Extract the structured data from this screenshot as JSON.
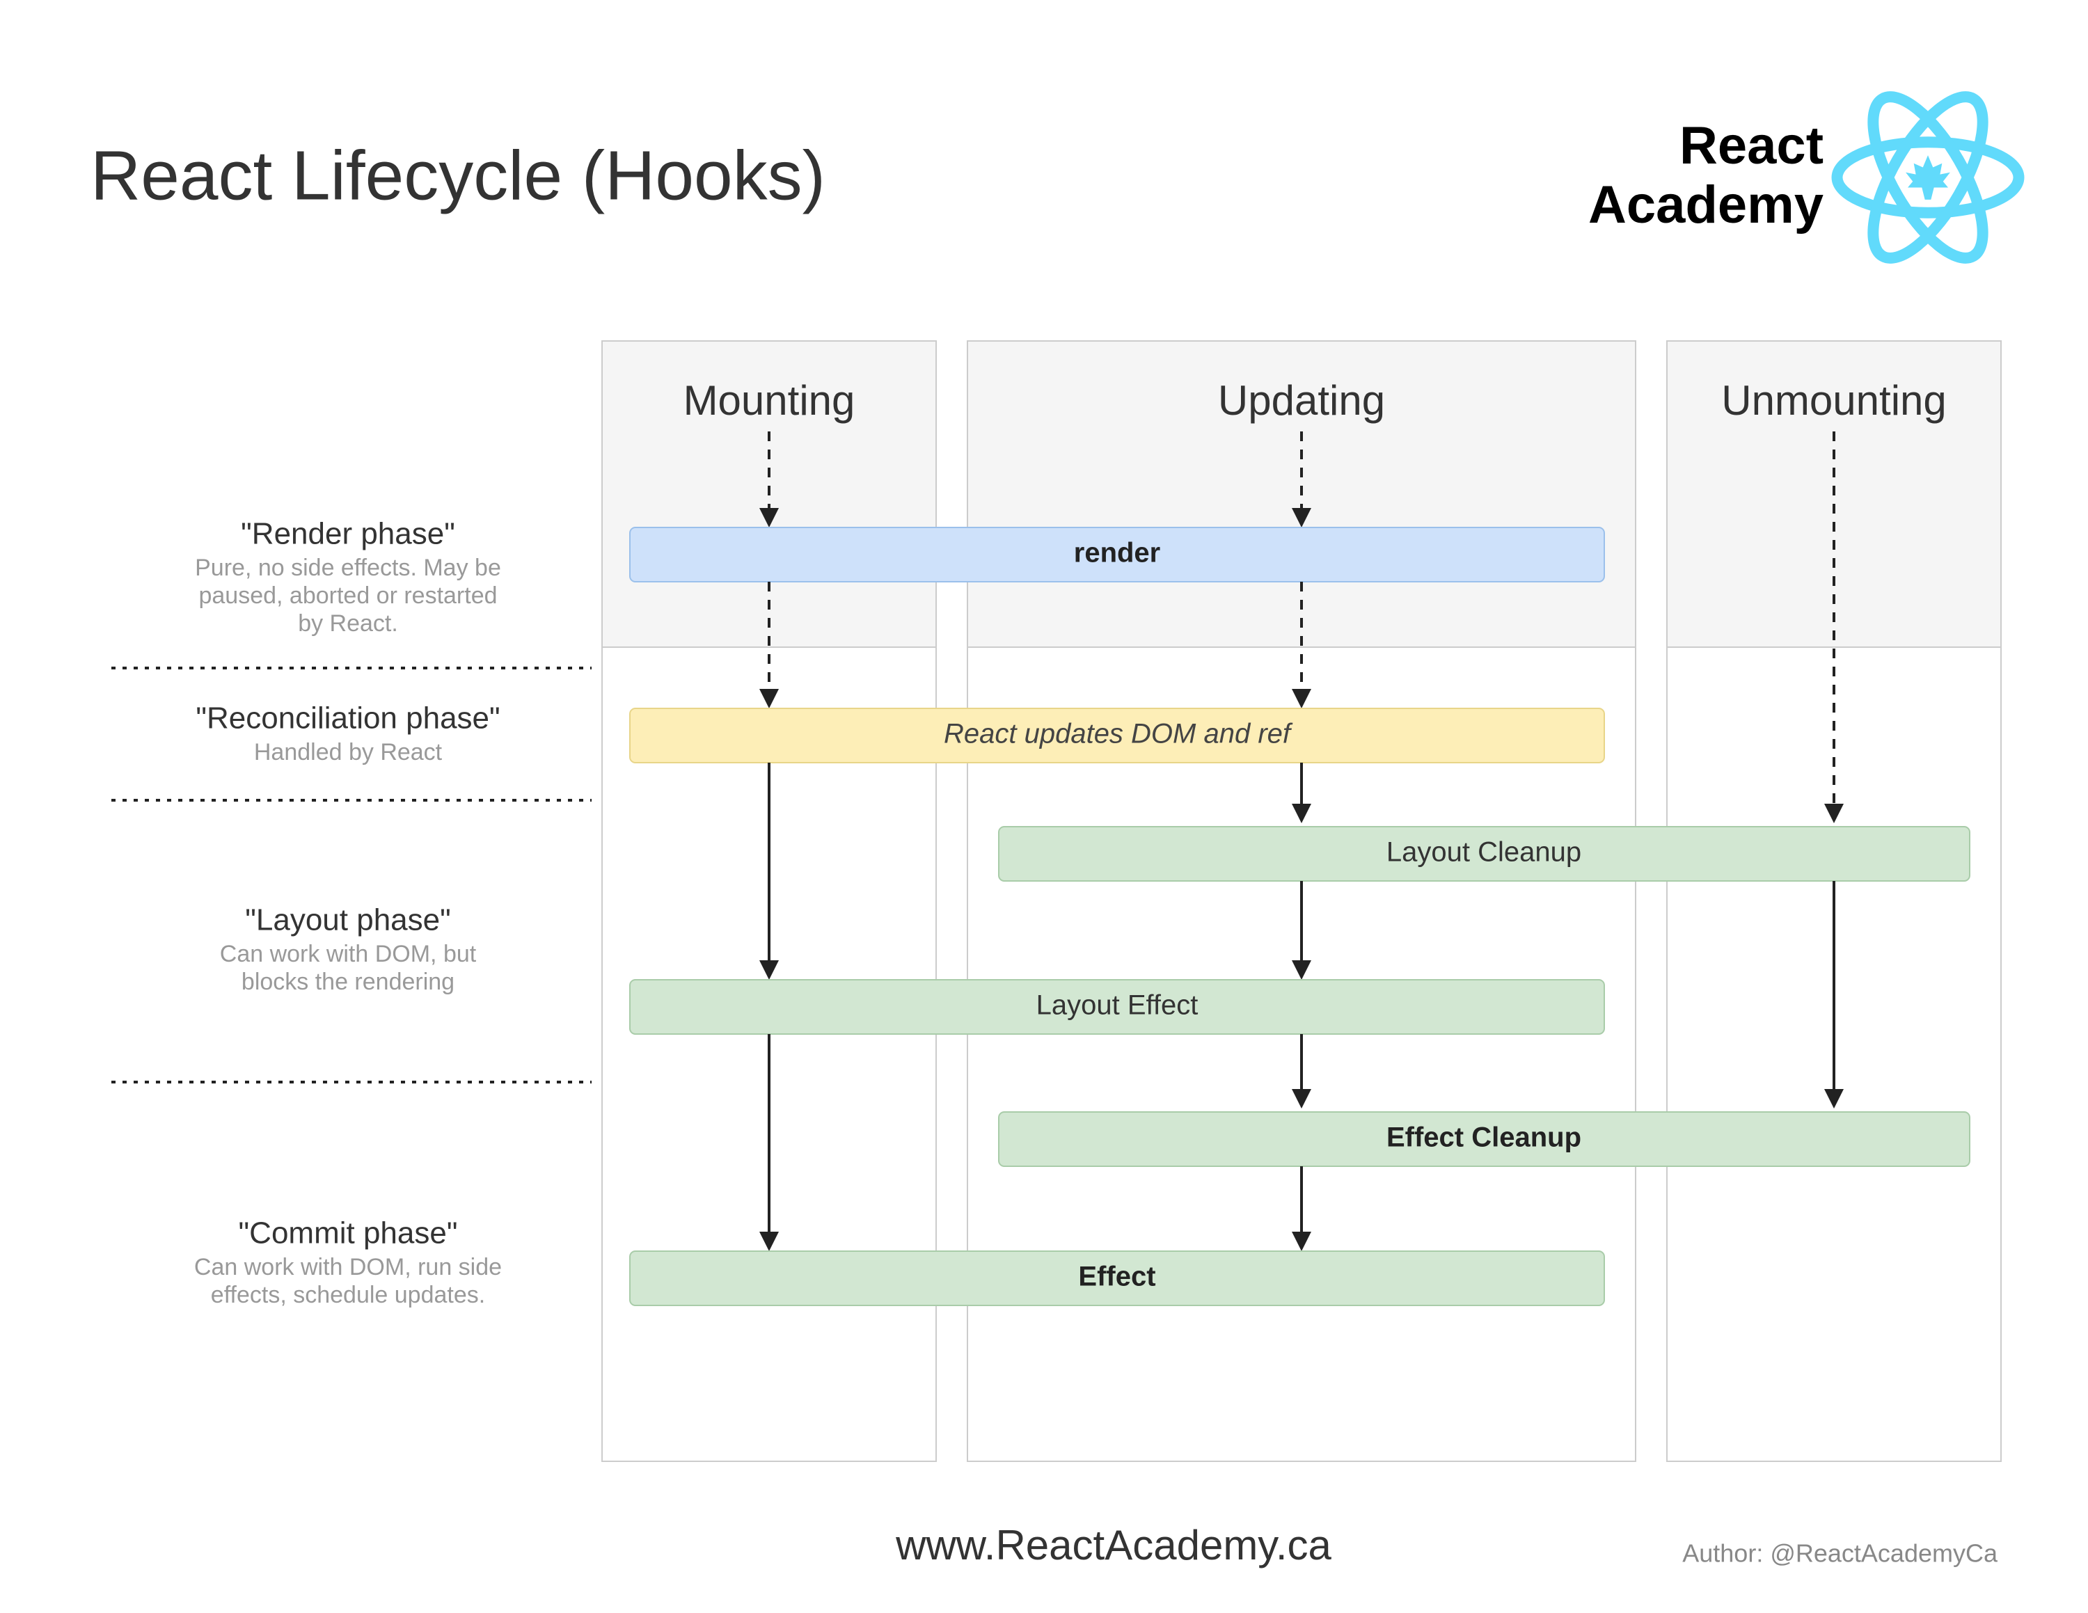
{
  "title": "React Lifecycle (Hooks)",
  "brand": {
    "line1": "React",
    "line2": "Academy"
  },
  "columns": {
    "mounting": "Mounting",
    "updating": "Updating",
    "unmounting": "Unmounting"
  },
  "phases": {
    "render": {
      "title": "\"Render phase\"",
      "desc": [
        "Pure, no side effects. May be",
        "paused, aborted or restarted",
        "by React."
      ]
    },
    "reconcile": {
      "title": "\"Reconciliation phase\"",
      "desc": [
        "Handled by React"
      ]
    },
    "layout": {
      "title": "\"Layout phase\"",
      "desc": [
        "Can work with DOM, but",
        "blocks the rendering"
      ]
    },
    "commit": {
      "title": "\"Commit phase\"",
      "desc": [
        "Can work with DOM, run side",
        "effects, schedule updates."
      ]
    }
  },
  "boxes": {
    "render": "render",
    "dom_update": "React updates DOM and ref",
    "layout_cleanup": "Layout Cleanup",
    "layout_effect": "Layout Effect",
    "effect_cleanup": "Effect Cleanup",
    "effect": "Effect"
  },
  "footer": {
    "url": "www.ReactAcademy.ca",
    "author": "Author: @ReactAcademyCa"
  },
  "colors": {
    "blue": "#cee1fa",
    "yellow": "#fdeeb7",
    "green": "#d2e7d2",
    "atom": "#61dafb"
  }
}
